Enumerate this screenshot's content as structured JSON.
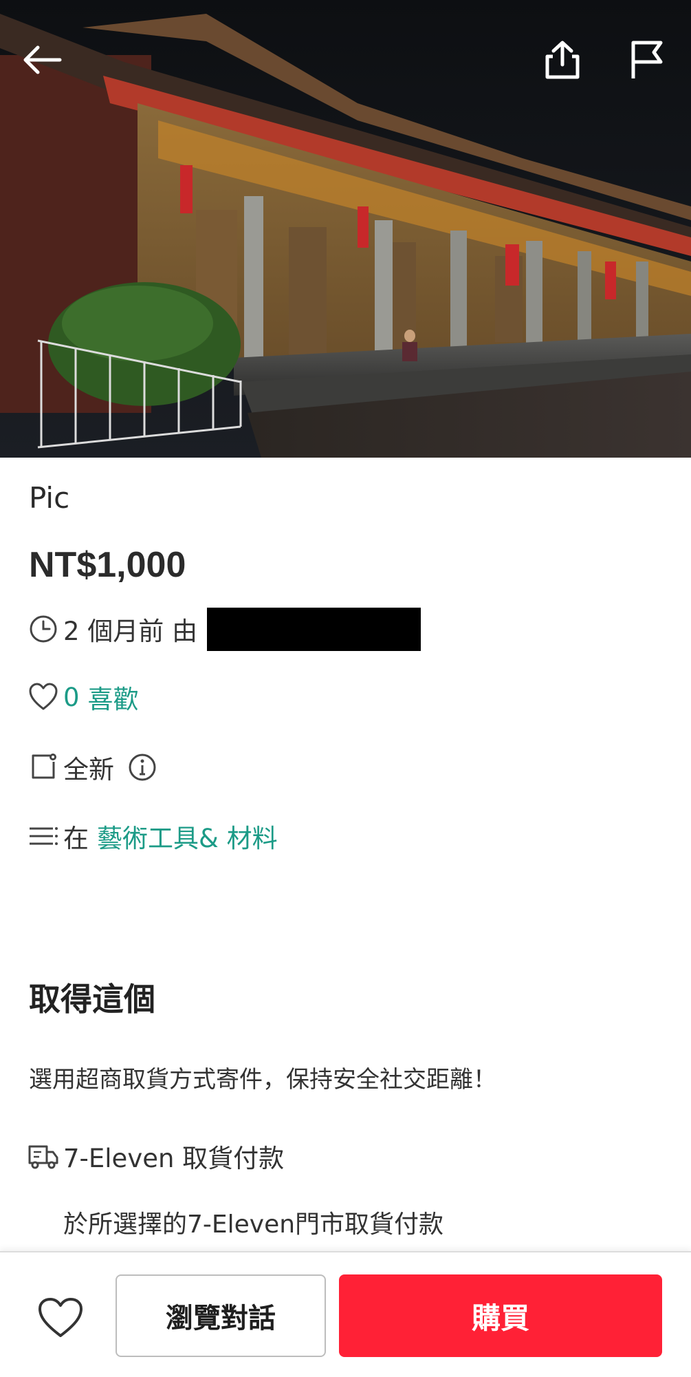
{
  "hero": {
    "image_alt": "temple-at-night-photo",
    "icons": {
      "back": "arrow-left-icon",
      "share": "share-icon",
      "report": "flag-icon"
    }
  },
  "listing": {
    "title": "Pic",
    "price": "NT$1,000",
    "posted": {
      "icon": "clock-icon",
      "text": "2 個月前 由"
    },
    "likes": {
      "icon": "heart-outline-icon",
      "count": "0",
      "label": "喜歡"
    },
    "condition": {
      "icon": "tag-icon",
      "text": "全新",
      "info_icon": "info-circle-icon"
    },
    "category": {
      "icon": "list-icon",
      "prefix": "在",
      "link": "藝術工具& 材料"
    }
  },
  "get_it": {
    "heading": "取得這個",
    "note": "選用超商取貨方式寄件，保持安全社交距離！",
    "method": {
      "icon": "delivery-truck-icon",
      "name": "7-Eleven 取貨付款",
      "detail": "於所選擇的7-Eleven門市取貨付款"
    }
  },
  "bottom_bar": {
    "favorite_icon": "heart-outline-icon",
    "chat_label": "瀏覽對話",
    "buy_label": "購買"
  },
  "colors": {
    "accent_teal": "#1c9b87",
    "buy_red": "#ff2136",
    "text": "#2a2a2a"
  }
}
